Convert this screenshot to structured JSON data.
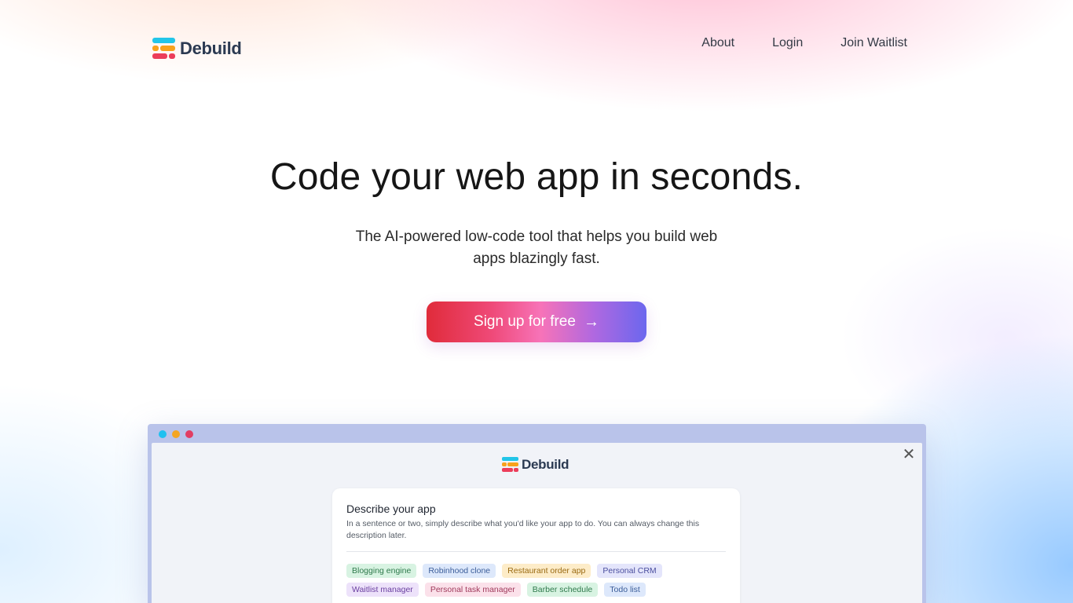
{
  "header": {
    "brand": "Debuild",
    "nav": [
      {
        "label": "About"
      },
      {
        "label": "Login"
      },
      {
        "label": "Join Waitlist"
      }
    ]
  },
  "hero": {
    "title": "Code your web app in seconds.",
    "subtitle": "The AI-powered low-code tool that helps you build web apps blazingly fast.",
    "cta_label": "Sign up for free",
    "cta_arrow": "→"
  },
  "mockup": {
    "brand": "Debuild",
    "close_glyph": "✕",
    "card": {
      "title": "Describe your app",
      "description": "In a sentence or two, simply describe what you'd like your app to do. You can always change this description later."
    },
    "chips": [
      {
        "label": "Blogging engine",
        "bg": "#d8f3e2",
        "fg": "#2f7a4c"
      },
      {
        "label": "Robinhood clone",
        "bg": "#dde8fb",
        "fg": "#3b5d99"
      },
      {
        "label": "Restaurant order app",
        "bg": "#fdecc8",
        "fg": "#9a6a12"
      },
      {
        "label": "Personal CRM",
        "bg": "#e4e5fb",
        "fg": "#4a4e9e"
      },
      {
        "label": "Waitlist manager",
        "bg": "#ede2fa",
        "fg": "#6a3fa0"
      },
      {
        "label": "Personal task manager",
        "bg": "#fbe1ea",
        "fg": "#a03a5c"
      },
      {
        "label": "Barber schedule",
        "bg": "#d8f3e2",
        "fg": "#2f7a4c"
      },
      {
        "label": "Todo list",
        "bg": "#dde8fb",
        "fg": "#3b5d99"
      }
    ]
  },
  "colors": {
    "logo_cyan": "#22c5e8",
    "logo_orange": "#f8a21c",
    "logo_red": "#ec3d5a",
    "dot_blue": "#1ec0f0",
    "dot_orange": "#f4a522",
    "dot_red": "#e23d63"
  }
}
